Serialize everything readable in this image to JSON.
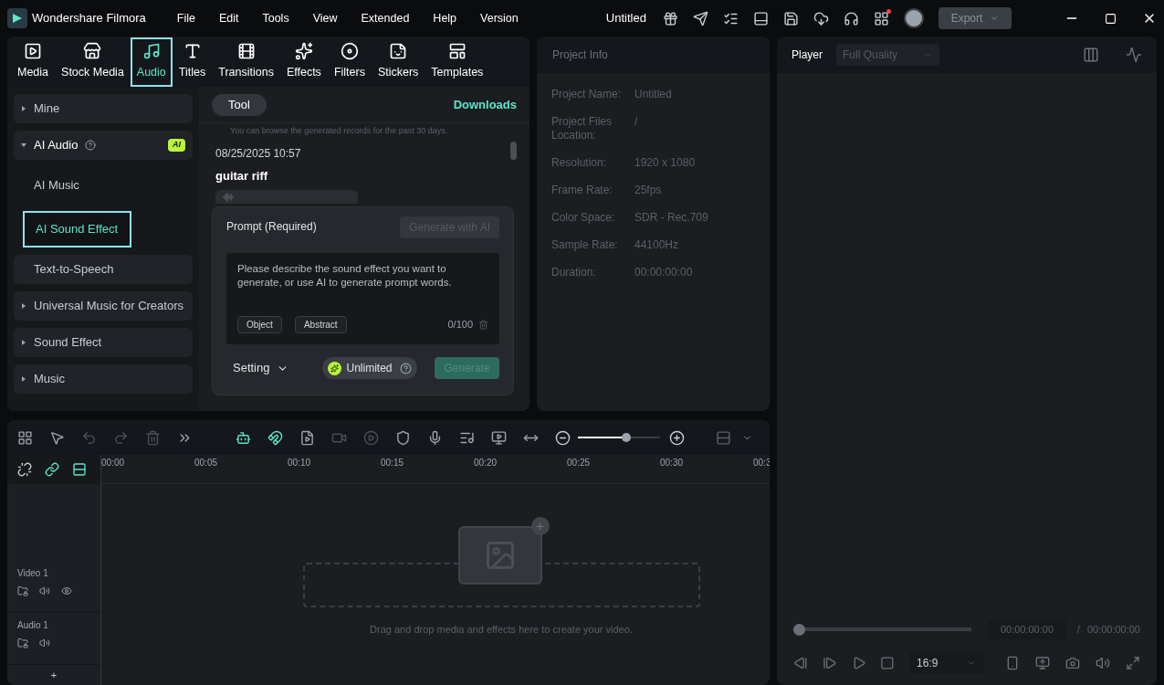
{
  "app": {
    "name": "Wondershare Filmora",
    "menus": [
      "File",
      "Edit",
      "Tools",
      "View",
      "Extended",
      "Help",
      "Version"
    ],
    "title": "Untitled",
    "notification_dot": true,
    "export": {
      "label": "Export",
      "disabled": true
    }
  },
  "toolbar_tabs": [
    {
      "label": "Media",
      "selected": false
    },
    {
      "label": "Stock Media",
      "selected": false
    },
    {
      "label": "Audio",
      "selected": true
    },
    {
      "label": "Titles",
      "selected": false
    },
    {
      "label": "Transitions",
      "selected": false
    },
    {
      "label": "Effects",
      "selected": false
    },
    {
      "label": "Filters",
      "selected": false
    },
    {
      "label": "Stickers",
      "selected": false
    },
    {
      "label": "Templates",
      "selected": false
    }
  ],
  "sidebar": [
    {
      "kind": "group",
      "label": "Mine",
      "expanded": false
    },
    {
      "kind": "group",
      "label": "AI Audio",
      "expanded": true,
      "badge": "AI",
      "children": [
        {
          "label": "AI Music",
          "selected": false
        },
        {
          "label": "AI Sound Effect",
          "selected": true
        }
      ]
    },
    {
      "kind": "item",
      "label": "Text-to-Speech"
    },
    {
      "kind": "group",
      "label": "Universal Music for Creators",
      "expanded": false
    },
    {
      "kind": "group",
      "label": "Sound Effect",
      "expanded": false
    },
    {
      "kind": "group",
      "label": "Music",
      "expanded": false
    }
  ],
  "content": {
    "tab": "Tool",
    "downloads": "Downloads",
    "notice": "You can browse the generated records for the past 30 days.",
    "record": {
      "time": "08/25/2025 10:57",
      "title": "guitar riff"
    },
    "prompt": {
      "label": "Prompt (Required)",
      "ai_button": {
        "label": "Generate with AI",
        "disabled": true
      },
      "placeholder": "Please describe the sound effect you want to generate, or use AI to generate prompt words.",
      "chips": [
        "Object",
        "Abstract"
      ],
      "counter": "0/100",
      "setting": "Setting",
      "plan": "Unlimited",
      "generate": {
        "label": "Generate",
        "disabled": true
      }
    }
  },
  "project_info": {
    "title": "Project Info",
    "rows": [
      {
        "label": "Project Name:",
        "value": "Untitled"
      },
      {
        "label": "Project Files Location:",
        "value": "/"
      },
      {
        "label": "Resolution:",
        "value": "1920 x 1080"
      },
      {
        "label": "Frame Rate:",
        "value": "25fps"
      },
      {
        "label": "Color Space:",
        "value": "SDR - Rec.709"
      },
      {
        "label": "Sample Rate:",
        "value": "44100Hz"
      },
      {
        "label": "Duration:",
        "value": "00:00:00:00"
      }
    ]
  },
  "player": {
    "tab": "Player",
    "quality": "Full Quality",
    "progress": {
      "level": 0
    },
    "current_time": "00:00:00:00",
    "separator": "/",
    "total_time": "00:00:00:00",
    "ratio": "16:9"
  },
  "timeline": {
    "zoom": {
      "level": 0.6
    },
    "ruler": [
      "00:00",
      "00:05",
      "00:10",
      "00:15",
      "00:20",
      "00:25",
      "00:30",
      "00:3"
    ],
    "tracks": [
      {
        "name": "Video 1",
        "kind": "video"
      },
      {
        "name": "Audio 1",
        "kind": "audio"
      }
    ],
    "add": "+",
    "drop_hint": "Drag and drop media and effects here to create your video."
  }
}
